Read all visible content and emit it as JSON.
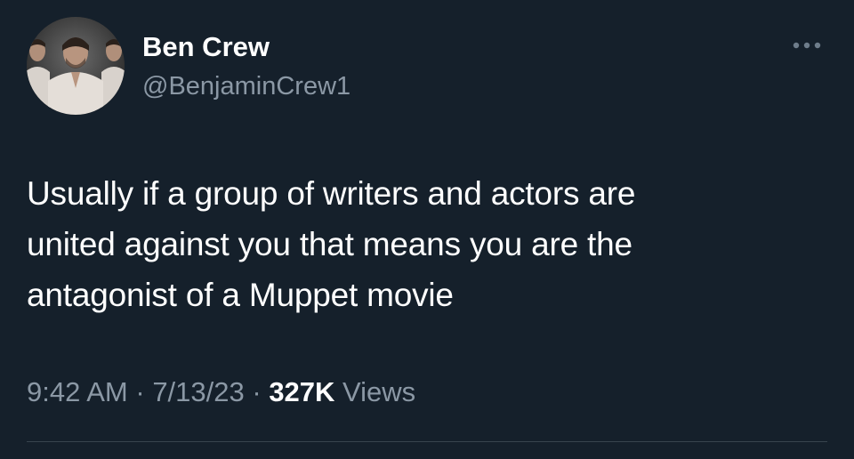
{
  "author": {
    "display_name": "Ben Crew",
    "handle": "@BenjaminCrew1",
    "avatar_icon": "avatar-photo"
  },
  "more_icon": "more-horizontal-icon",
  "tweet": {
    "text_lines": [
      "Usually if a group of writers and actors are",
      "united against you that means you are the",
      "antagonist of a Muppet movie"
    ]
  },
  "meta": {
    "time": "9:42 AM",
    "separator": " · ",
    "date": "7/13/23",
    "views_count": "327K",
    "views_label": " Views"
  },
  "colors": {
    "background": "#15202b",
    "primary_text": "#ffffff",
    "secondary_text": "#8b98a5",
    "divider": "#38444d"
  }
}
